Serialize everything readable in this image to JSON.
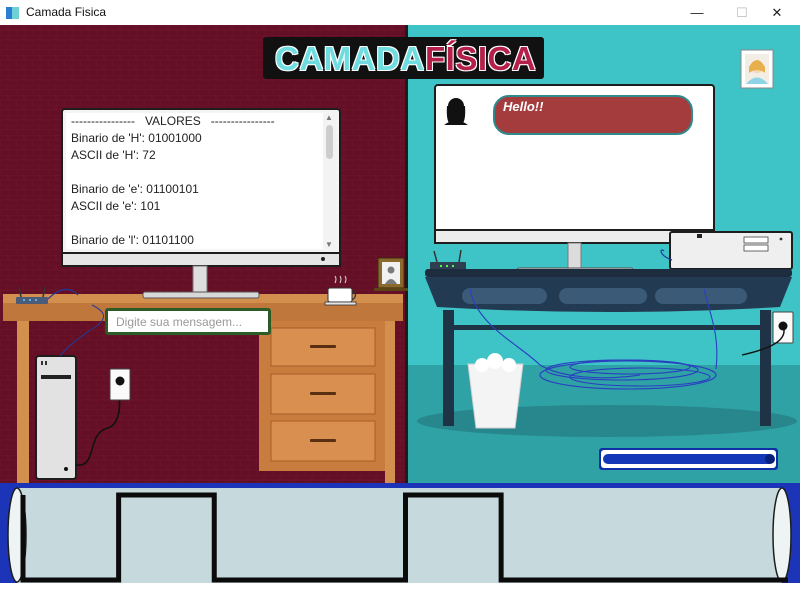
{
  "window": {
    "title": "Camada Fisica",
    "controls": {
      "minimize": "—",
      "maximize": "☐",
      "close": "✕"
    }
  },
  "heading": {
    "part1": "CAMADA",
    "part2": "FÍSICA"
  },
  "values_panel": {
    "lines": [
      "----------------   VALORES   ----------------",
      "Binario de 'H': 01001000",
      "ASCII de 'H': 72",
      "",
      "Binario de 'e': 01100101",
      "ASCII de 'e': 101",
      "",
      "Binario de 'l': 01101100"
    ]
  },
  "message_input": {
    "placeholder": "Digite sua mensagem...",
    "value": ""
  },
  "chat_bubble": {
    "text": "Hello!!"
  },
  "progress": {
    "value": 1.0
  },
  "signal": {
    "bits": [
      0,
      1,
      0,
      0,
      1,
      0,
      0,
      0
    ]
  },
  "colors": {
    "left_wall": "#640f25",
    "right_wall": "#3ec4c6",
    "accent_green": "#2b5c27",
    "bubble": "#a43c3e",
    "progress": "#0e2fa6"
  },
  "icons": {
    "app": "app-icon",
    "sender_avatar": "woman-silhouette-icon",
    "receiver_avatar": "woman-portrait-icon"
  }
}
